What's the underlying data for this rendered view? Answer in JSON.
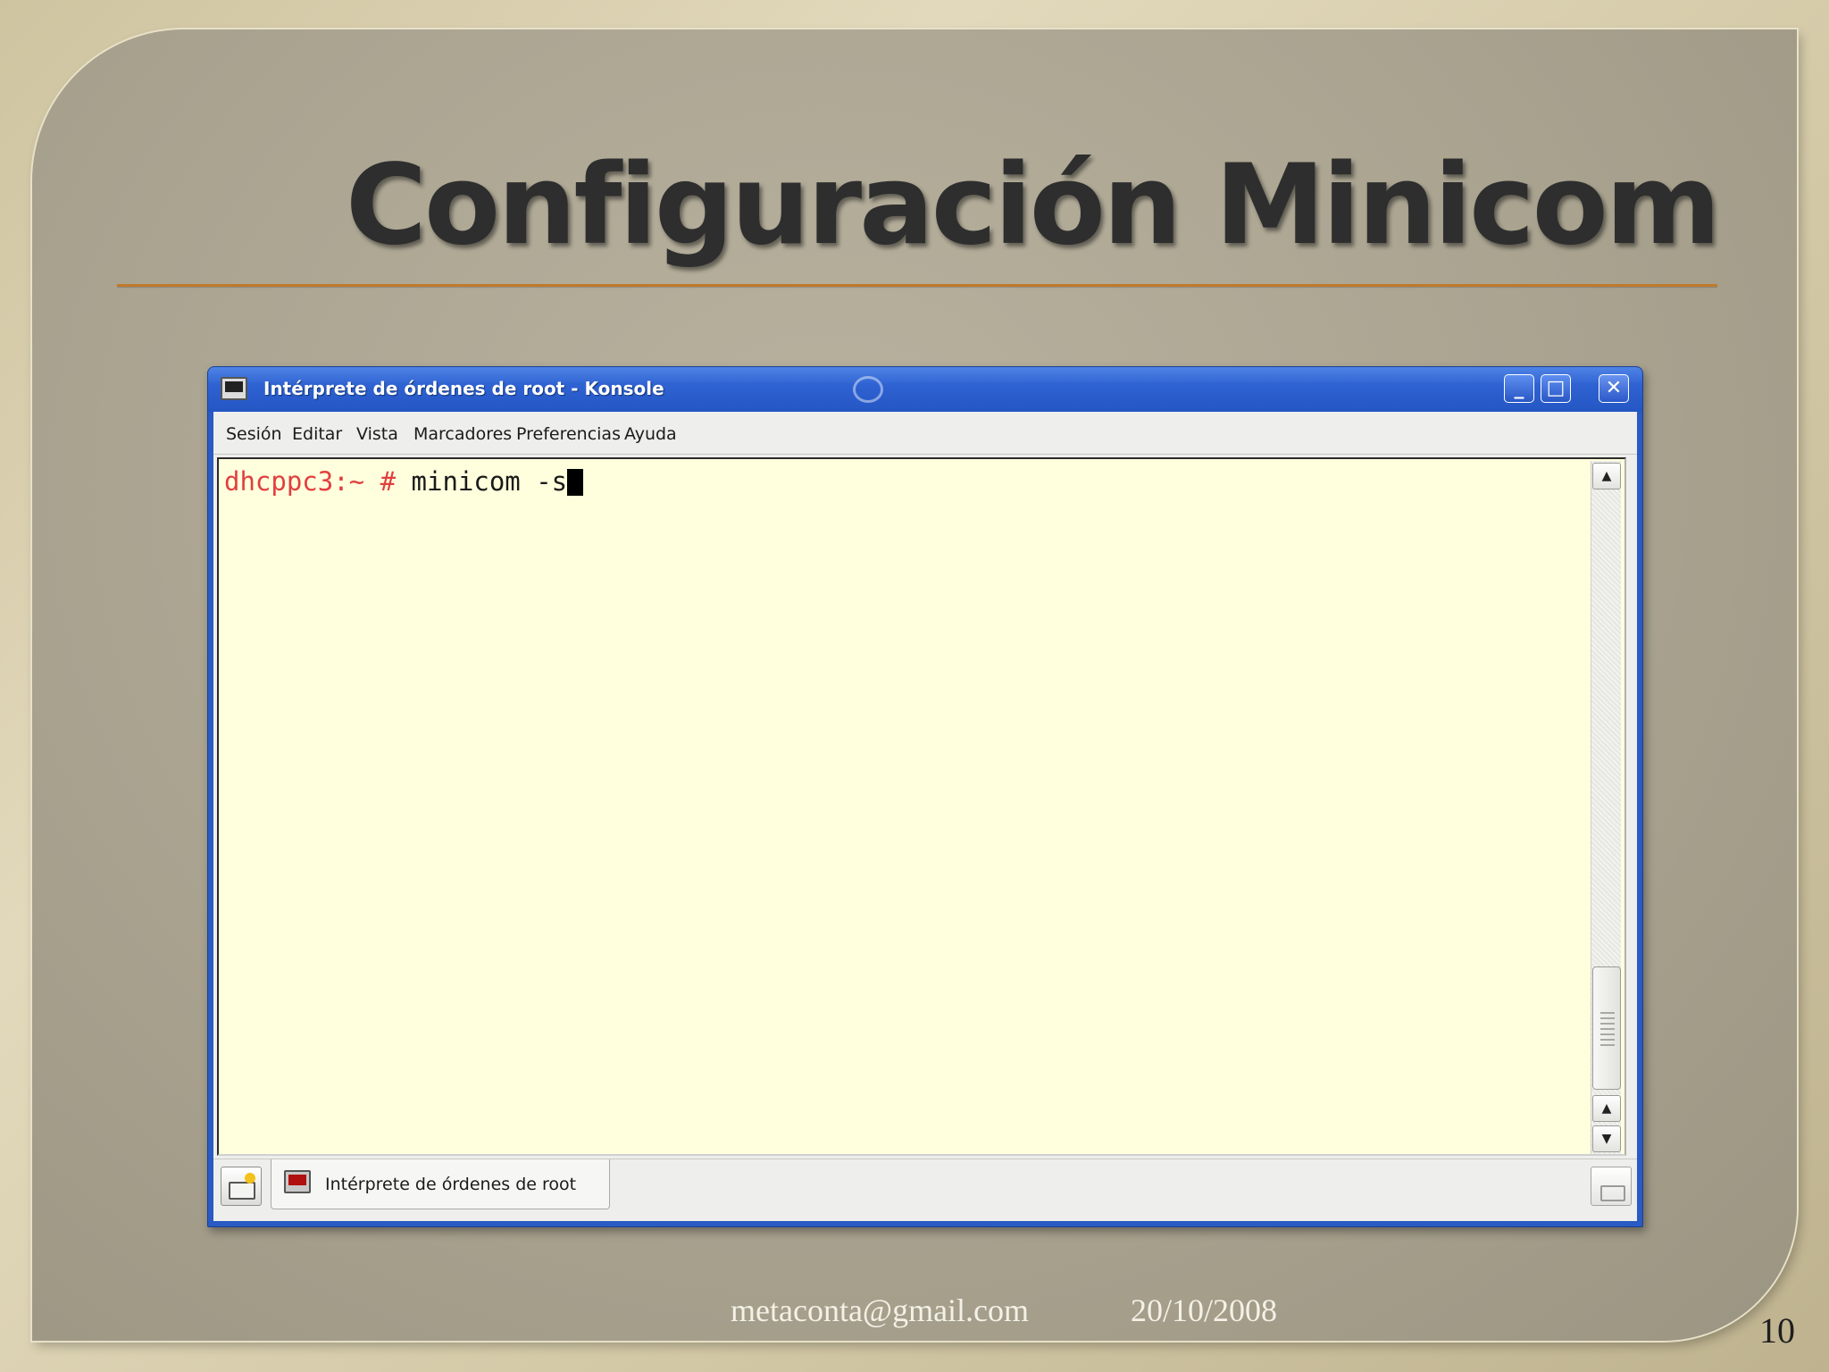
{
  "slide": {
    "title": "Configuración Minicom",
    "footer_email": "metaconta@gmail.com",
    "footer_date": "20/10/2008",
    "page_number": "10"
  },
  "window": {
    "title": "Intérprete de órdenes de root - Konsole",
    "controls": {
      "minimize": "_",
      "maximize": "□",
      "close": "✕"
    },
    "menu": [
      "Sesión",
      "Editar",
      "Vista",
      "Marcadores",
      "Preferencias",
      "Ayuda"
    ],
    "terminal": {
      "prompt": "dhcppc3:~ #",
      "command": " minicom -s"
    },
    "scrollbar": {
      "up": "▲",
      "down": "▼"
    },
    "tab_label": "Intérprete de órdenes de root"
  },
  "colors": {
    "titlebar": "#2f62d2",
    "terminal_background": "#ffffdd",
    "prompt": "#e04040",
    "title_rule": "#c07a2c"
  },
  "icons": [
    "konsole-icon",
    "swirl-icon",
    "new-session-icon",
    "terminal-tab-icon",
    "close-session-icon"
  ]
}
